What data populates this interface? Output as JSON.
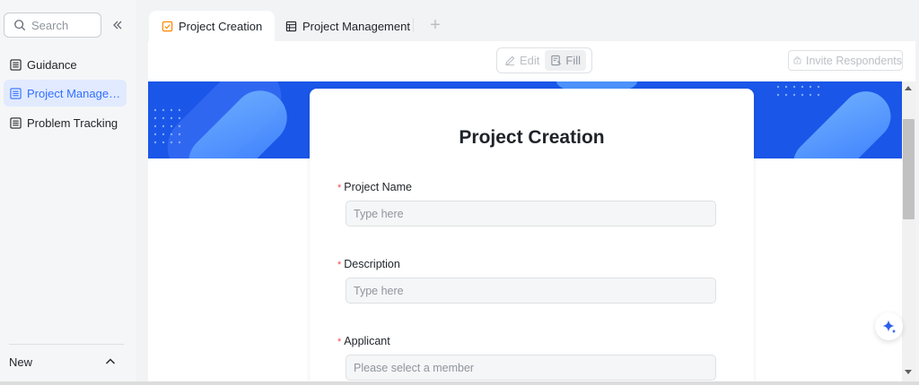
{
  "sidebar": {
    "search_placeholder": "Search",
    "collapse_icon": "double-chevron-left-icon",
    "items": [
      {
        "label": "Guidance",
        "icon": "table-icon",
        "active": false
      },
      {
        "label": "Project Managem...",
        "icon": "table-icon",
        "active": true
      },
      {
        "label": "Problem Tracking",
        "icon": "table-icon",
        "active": false
      }
    ],
    "new_label": "New",
    "new_icon": "chevron-up-icon"
  },
  "tabs": [
    {
      "label": "Project Creation",
      "icon": "form-check-icon",
      "active": true
    },
    {
      "label": "Project Management",
      "icon": "grid-table-icon",
      "active": false
    }
  ],
  "tab_add_label": "+",
  "toolbar": {
    "edit_label": "Edit",
    "fill_label": "Fill",
    "invite_label": "Invite Respondents"
  },
  "form": {
    "title": "Project Creation",
    "fields": [
      {
        "label": "Project Name",
        "required": "*",
        "placeholder": "Type here"
      },
      {
        "label": "Description",
        "required": "*",
        "placeholder": "Type here"
      },
      {
        "label": "Applicant",
        "required": "*",
        "placeholder": "Please select a member"
      }
    ]
  },
  "colors": {
    "accent": "#3370ff",
    "banner": "#1a56e8",
    "required": "#f54a45",
    "tab_icon": "#ff8800"
  }
}
